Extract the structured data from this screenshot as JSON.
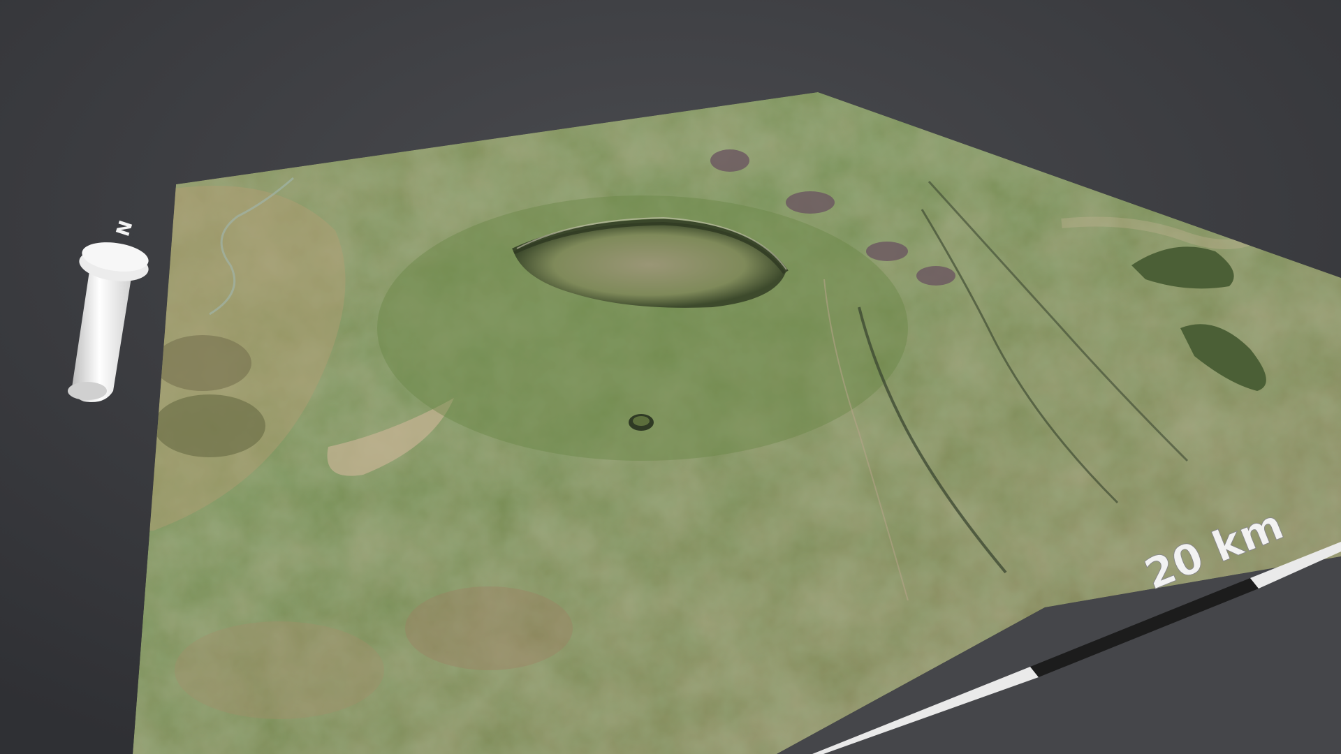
{
  "scene": {
    "background_colors": [
      "#2e2f33",
      "#46474b"
    ],
    "terrain_colors": {
      "grass": "#6f8a4e",
      "dry": "#a8906a",
      "dark_ridge": "#4a5a36",
      "crater_floor": "#8f8a6a",
      "lava": "#6a5560"
    }
  },
  "compass": {
    "label": "N",
    "icon": "north-arrow-icon",
    "color": "#e8e8e8"
  },
  "scale_bar": {
    "label": "20 km",
    "segments": [
      "white",
      "black",
      "white"
    ],
    "colors": {
      "light": "#eaeaea",
      "dark": "#1c1c1c"
    }
  }
}
